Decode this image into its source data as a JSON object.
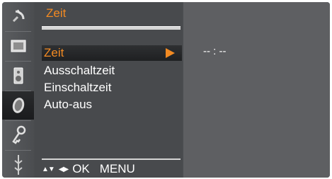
{
  "menu": {
    "title": "Zeit",
    "items": [
      {
        "label": "Zeit",
        "selected": true
      },
      {
        "label": "Ausschaltzeit",
        "selected": false
      },
      {
        "label": "Einschaltzeit",
        "selected": false
      },
      {
        "label": "Auto-aus",
        "selected": false
      }
    ]
  },
  "footer": {
    "updown": "▲▼",
    "leftright": "◀▶",
    "ok": "OK",
    "menu": "MENU"
  },
  "value": {
    "time": "-- : --"
  },
  "sidebar": {
    "icons": [
      "satellite-dish-icon",
      "picture-icon",
      "speaker-icon",
      "clock-icon",
      "key-icon",
      "plug-icon"
    ],
    "active_index": 3
  },
  "colors": {
    "accent": "#f28a22",
    "panel": "#484a4d",
    "value_panel": "#5e5f62"
  }
}
